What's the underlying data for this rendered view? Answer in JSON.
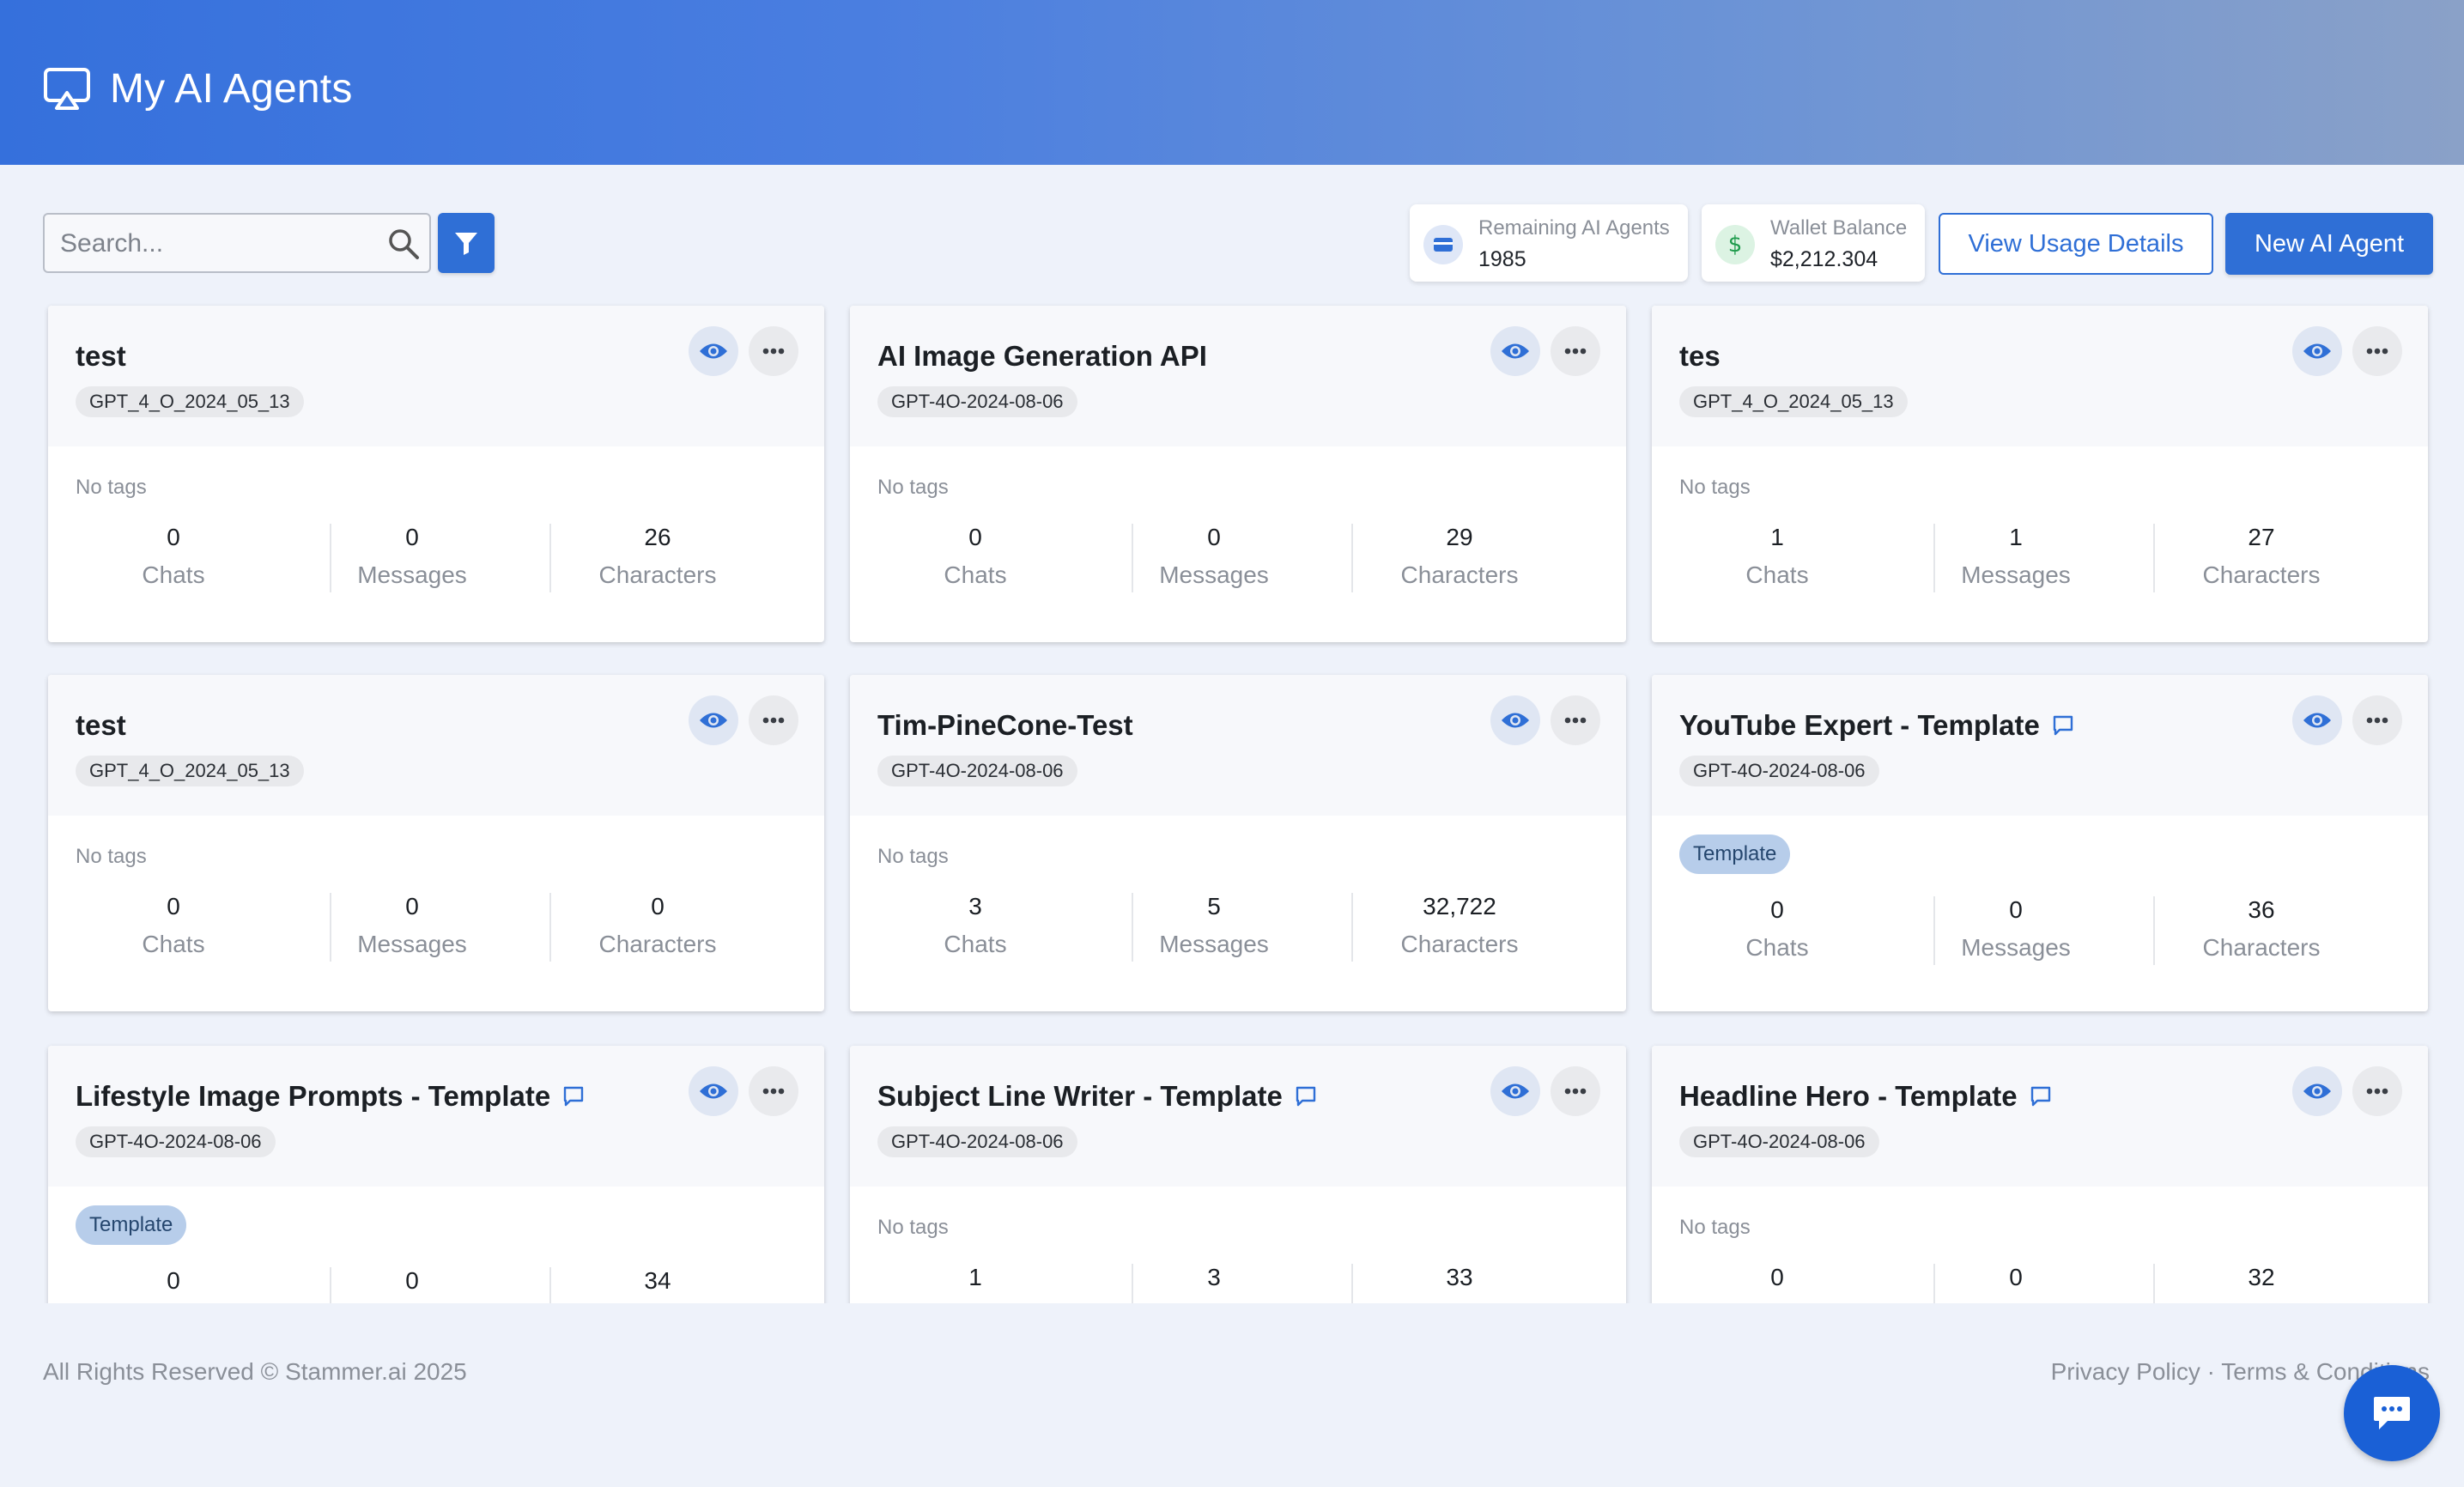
{
  "header": {
    "title": "My AI Agents",
    "icon": "airplay-icon",
    "gradient": [
      "#3570dc",
      "#8aa1c8"
    ]
  },
  "toolbar": {
    "search_placeholder": "Search...",
    "search_value": "",
    "remaining_label": "Remaining AI Agents",
    "remaining_value": "1985",
    "wallet_label": "Wallet Balance",
    "wallet_value": "$2,212.304",
    "view_usage_label": "View Usage Details",
    "new_agent_label": "New AI Agent"
  },
  "colors": {
    "accent": "#2f6fd6",
    "tag_bg": "#b7cdea",
    "page_bg": "#eef2fa"
  },
  "stat_labels": {
    "chats": "Chats",
    "messages": "Messages",
    "characters": "Characters"
  },
  "agents": [
    {
      "name": "test",
      "model": "GPT_4_O_2024_05_13",
      "tags": "No tags",
      "template": false,
      "chats": "0",
      "messages": "0",
      "characters": "26"
    },
    {
      "name": "AI Image Generation API",
      "model": "GPT-4O-2024-08-06",
      "tags": "No tags",
      "template": false,
      "chats": "0",
      "messages": "0",
      "characters": "29"
    },
    {
      "name": "tes",
      "model": "GPT_4_O_2024_05_13",
      "tags": "No tags",
      "template": false,
      "chats": "1",
      "messages": "1",
      "characters": "27"
    },
    {
      "name": "test",
      "model": "GPT_4_O_2024_05_13",
      "tags": "No tags",
      "template": false,
      "chats": "0",
      "messages": "0",
      "characters": "0"
    },
    {
      "name": "Tim-PineCone-Test",
      "model": "GPT-4O-2024-08-06",
      "tags": "No tags",
      "template": false,
      "chats": "3",
      "messages": "5",
      "characters": "32,722"
    },
    {
      "name": "YouTube Expert - Template",
      "model": "GPT-4O-2024-08-06",
      "tags": "Template",
      "template": true,
      "chats": "0",
      "messages": "0",
      "characters": "36"
    },
    {
      "name": "Lifestyle Image Prompts - Template",
      "model": "GPT-4O-2024-08-06",
      "tags": "Template",
      "template": true,
      "chats": "0",
      "messages": "0",
      "characters": "34"
    },
    {
      "name": "Subject Line Writer - Template",
      "model": "GPT-4O-2024-08-06",
      "tags": "No tags",
      "template": true,
      "chats": "1",
      "messages": "3",
      "characters": "33"
    },
    {
      "name": "Headline Hero - Template",
      "model": "GPT-4O-2024-08-06",
      "tags": "No tags",
      "template": true,
      "chats": "0",
      "messages": "0",
      "characters": "32"
    }
  ],
  "footer": {
    "copyright": "All Rights Reserved © Stammer.ai 2025",
    "privacy": "Privacy Policy",
    "separator": "·",
    "terms": "Terms & Conditions"
  }
}
